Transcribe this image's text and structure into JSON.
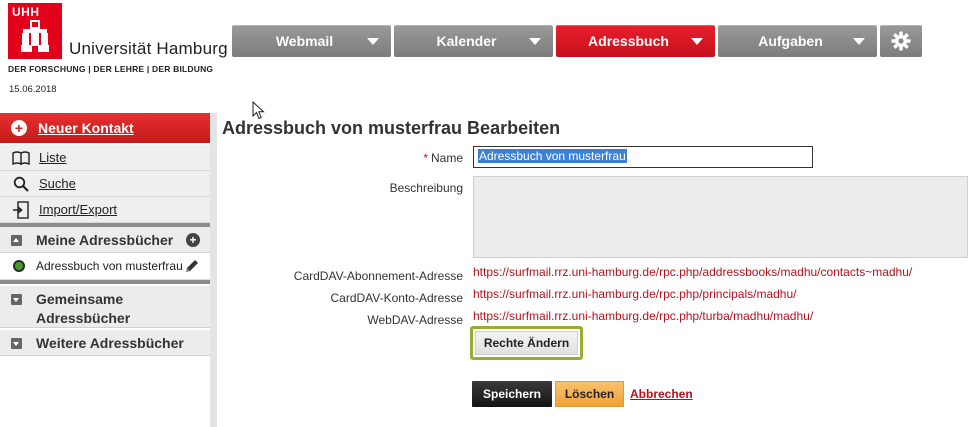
{
  "header": {
    "logo_mark": "UHH",
    "university": "Universität Hamburg",
    "tagline": "DER FORSCHUNG | DER LEHRE | DER BILDUNG",
    "date": "15.06.2018"
  },
  "nav": {
    "items": [
      {
        "label": "Webmail",
        "active": false
      },
      {
        "label": "Kalender",
        "active": false
      },
      {
        "label": "Adressbuch",
        "active": true
      },
      {
        "label": "Aufgaben",
        "active": false
      }
    ],
    "settings_icon": "gear-icon"
  },
  "sidebar": {
    "new_contact": "Neuer Kontakt",
    "items": [
      {
        "label": "Liste",
        "icon": "book-icon"
      },
      {
        "label": "Suche",
        "icon": "search-icon"
      },
      {
        "label": "Import/Export",
        "icon": "import-export-icon"
      }
    ],
    "my_books_header": "Meine Adressbücher",
    "my_books": [
      {
        "label": "Adressbuch von musterfrau"
      }
    ],
    "shared_header": "Gemeinsame Adressbücher",
    "more_header": "Weitere Adressbücher"
  },
  "main": {
    "title": "Adressbuch von musterfrau Bearbeiten",
    "required_marker": "*",
    "name_label": "Name",
    "name_value": "Adressbuch von musterfrau",
    "description_label": "Beschreibung",
    "description_value": "",
    "carddav_subscription_label": "CardDAV-Abonnement-Adresse",
    "carddav_subscription_url": "https://surfmail.rrz.uni-hamburg.de/rpc.php/addressbooks/madhu/contacts~madhu/",
    "carddav_account_label": "CardDAV-Konto-Adresse",
    "carddav_account_url": "https://surfmail.rrz.uni-hamburg.de/rpc.php/principals/madhu/",
    "webdav_label": "WebDAV-Adresse",
    "webdav_url": "https://surfmail.rrz.uni-hamburg.de/rpc.php/turba/madhu/madhu/",
    "rights_button": "Rechte Ändern",
    "save_button": "Speichern",
    "delete_button": "Löschen",
    "cancel_link": "Abbrechen"
  },
  "colors": {
    "brand_red": "#e2001a",
    "nav_grey": "#8a8a8a",
    "link_red": "#b3121e",
    "highlight_olive": "#9bab30",
    "delete_orange": "#f0a23a"
  }
}
